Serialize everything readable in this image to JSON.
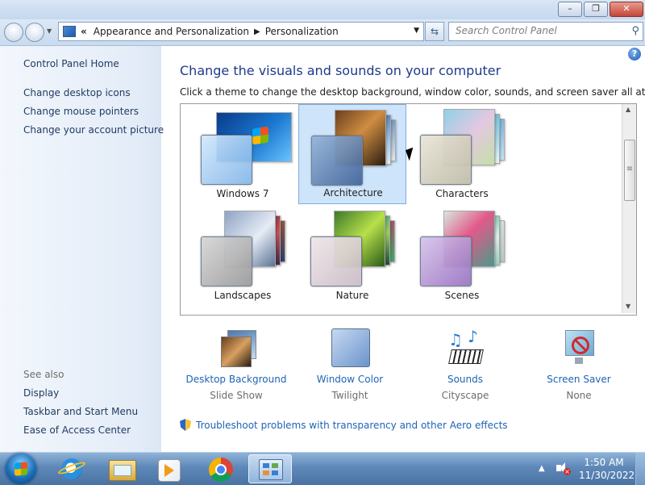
{
  "window": {
    "buttons": [
      "minimize",
      "restore",
      "close"
    ]
  },
  "address": {
    "breadcrumb_prefix": "«",
    "crumbs": [
      "Appearance and Personalization",
      "Personalization"
    ],
    "search_placeholder": "Search Control Panel"
  },
  "sidebar": {
    "home": "Control Panel Home",
    "links": [
      "Change desktop icons",
      "Change mouse pointers",
      "Change your account picture"
    ],
    "see_also_label": "See also",
    "see_also": [
      "Display",
      "Taskbar and Start Menu",
      "Ease of Access Center"
    ]
  },
  "main": {
    "heading": "Change the visuals and sounds on your computer",
    "subheading": "Click a theme to change the desktop background, window color, sounds, and screen saver all at once.",
    "themes": [
      {
        "name": "Windows 7",
        "selected": false
      },
      {
        "name": "Architecture",
        "selected": true
      },
      {
        "name": "Characters",
        "selected": false
      },
      {
        "name": "Landscapes",
        "selected": false
      },
      {
        "name": "Nature",
        "selected": false
      },
      {
        "name": "Scenes",
        "selected": false
      }
    ],
    "options": [
      {
        "label": "Desktop Background",
        "value": "Slide Show",
        "icon": "desktop-background-icon"
      },
      {
        "label": "Window Color",
        "value": "Twilight",
        "icon": "window-color-icon"
      },
      {
        "label": "Sounds",
        "value": "Cityscape",
        "icon": "sounds-icon"
      },
      {
        "label": "Screen Saver",
        "value": "None",
        "icon": "screen-saver-icon"
      }
    ],
    "troubleshoot": "Troubleshoot problems with transparency and other Aero effects"
  },
  "taskbar": {
    "apps": [
      "internet-explorer-icon",
      "file-explorer-icon",
      "media-player-icon",
      "chrome-icon",
      "control-panel-icon"
    ],
    "active_app": "control-panel-icon",
    "time": "1:50 AM",
    "date": "11/30/2022"
  },
  "colors": {
    "link": "#1e64b4",
    "heading": "#1e3a8a",
    "selected_theme": "#cde4fb"
  }
}
